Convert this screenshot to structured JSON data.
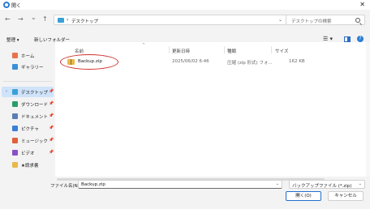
{
  "window": {
    "title": "開く",
    "close_label": "✕"
  },
  "nav": {
    "back": "←",
    "forward": "→",
    "dropdown": "⌄",
    "up": "↑",
    "address_sep": "›",
    "address_path": "デスクトップ",
    "address_chevron": "⌄",
    "refresh": "↻",
    "search_placeholder": "デスクトップの検索"
  },
  "commands": {
    "organize": "整理 ▾",
    "new_folder": "新しいフォルダー",
    "view_toggle": "☰ ▾",
    "help": "?"
  },
  "sidebar": {
    "items": [
      {
        "label": "ホーム",
        "icon": "home-icon",
        "color": "#e8734a",
        "selected": false,
        "pinned": false
      },
      {
        "label": "ギャラリー",
        "icon": "gallery-icon",
        "color": "#3a8fd8",
        "selected": false,
        "pinned": false
      },
      {
        "label": "デスクトップ",
        "icon": "desktop-icon",
        "color": "#3aa0d8",
        "selected": true,
        "pinned": true
      },
      {
        "label": "ダウンロード",
        "icon": "download-icon",
        "color": "#2a9d6a",
        "selected": false,
        "pinned": true
      },
      {
        "label": "ドキュメント",
        "icon": "document-icon",
        "color": "#5a7fb5",
        "selected": false,
        "pinned": true
      },
      {
        "label": "ピクチャ",
        "icon": "picture-icon",
        "color": "#3a7fd8",
        "selected": false,
        "pinned": true
      },
      {
        "label": "ミュージック",
        "icon": "music-icon",
        "color": "#e0603a",
        "selected": false,
        "pinned": true
      },
      {
        "label": "ビデオ",
        "icon": "video-icon",
        "color": "#8a4fc7",
        "selected": false,
        "pinned": true
      },
      {
        "label": "★請求書",
        "icon": "folder-icon",
        "color": "#e8b84a",
        "selected": false,
        "pinned": false
      }
    ],
    "pin_glyph": "📌",
    "chevron": "›"
  },
  "columns": {
    "name": "名前",
    "modified": "更新日時",
    "type": "種類",
    "size": "サイズ",
    "sort_arrow": "^"
  },
  "files": [
    {
      "name": "Backup.zip",
      "modified": "2025/06/02 6:46",
      "type": "圧縮 (zip 形式) フォ...",
      "size": "162 KB"
    }
  ],
  "footer": {
    "filename_label": "ファイル名(N):",
    "filename_value": "Backup.zip",
    "filetype_value": "バックアップファイル (*.zip)",
    "chevron": "⌄",
    "open_label": "開く(O)",
    "cancel_label": "キャンセル"
  },
  "colors": {
    "accent": "#1f6fd0",
    "selection": "#cfe3fa",
    "highlight_ellipse": "#d0312d"
  }
}
